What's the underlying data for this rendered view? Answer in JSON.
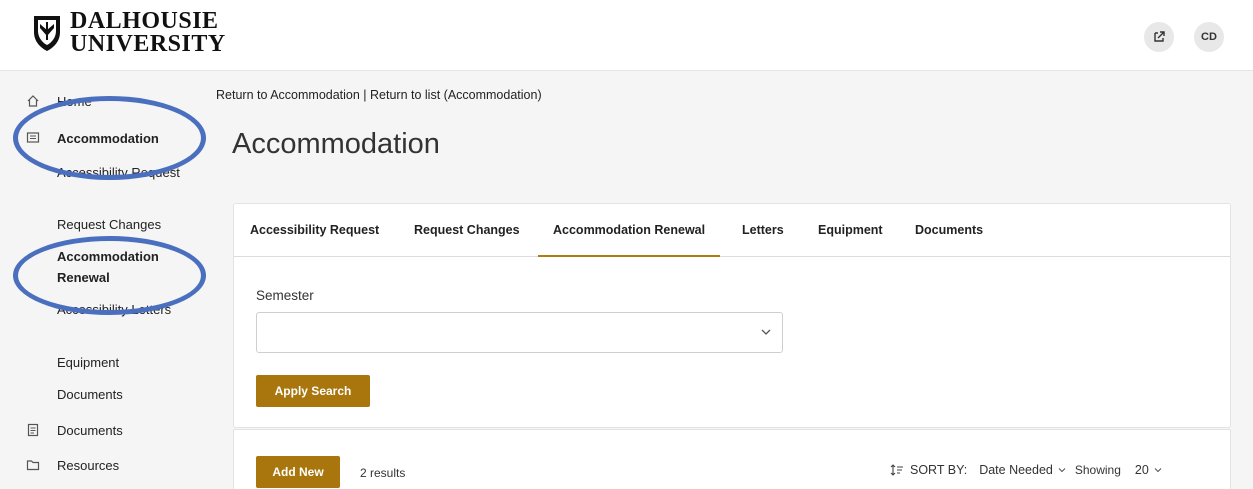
{
  "header": {
    "logo_line1": "DALHOUSIE",
    "logo_line2": "UNIVERSITY",
    "avatar_initials": "CD"
  },
  "sidebar": {
    "home": "Home",
    "accommodation": "Accommodation",
    "sub_items": [
      "Accessibility Request",
      "Request Changes",
      "Accommodation Renewal",
      "Accessibility Letters",
      "Equipment",
      "Documents"
    ],
    "documents": "Documents",
    "resources": "Resources"
  },
  "breadcrumb": "Return to Accommodation | Return to list (Accommodation)",
  "page_title": "Accommodation",
  "tabs": [
    "Accessibility Request",
    "Request Changes",
    "Accommodation Renewal",
    "Letters",
    "Equipment",
    "Documents"
  ],
  "active_tab": "Accommodation Renewal",
  "search": {
    "semester_label": "Semester",
    "semester_value": "",
    "apply_label": "Apply Search"
  },
  "results": {
    "add_label": "Add New",
    "count_text": "2 results",
    "sort_label": "SORT BY:",
    "sort_value": "Date Needed",
    "showing_label": "Showing",
    "showing_value": "20"
  },
  "colors": {
    "accent": "#a8760d",
    "highlight_ring": "#4a6fbf"
  }
}
